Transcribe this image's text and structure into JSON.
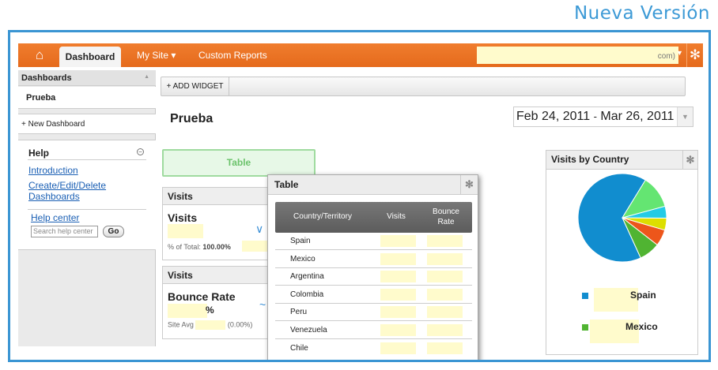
{
  "banner": "Nueva Versión",
  "topbar": {
    "tabs": [
      "Dashboard",
      "My Site ▾",
      "Custom Reports"
    ],
    "account_suffix": "com)"
  },
  "sidebar": {
    "dashboards_header": "Dashboards",
    "active_dashboard": "Prueba",
    "new_dashboard": "+ New Dashboard",
    "help": {
      "title": "Help",
      "links": [
        "Introduction",
        "Create/Edit/Delete",
        "Dashboards"
      ],
      "help_center": "Help center",
      "search_placeholder": "Search help center",
      "go": "Go"
    }
  },
  "toolbar": {
    "add_widget": "+ ADD WIDGET"
  },
  "page": {
    "title": "Prueba",
    "date_start": "Feb 24, 2011",
    "date_sep": "-",
    "date_end": "Mar 26, 2011"
  },
  "drop_placeholder": "Table",
  "visits_widget": {
    "title": "Visits",
    "metric": "Visits",
    "total_label": "% of Total:",
    "total_value": "100.00%"
  },
  "bounce_widget": {
    "title": "Visits",
    "metric": "Bounce Rate",
    "suffix": "%",
    "avg_label": "Site Avg",
    "avg_value": "(0.00%)"
  },
  "table_widget": {
    "title": "Table",
    "columns": [
      "Country/Territory",
      "Visits",
      "Bounce",
      "Rate"
    ],
    "rows": [
      "Spain",
      "Mexico",
      "Argentina",
      "Colombia",
      "Peru",
      "Venezuela",
      "Chile"
    ]
  },
  "country_widget": {
    "title": "Visits by Country",
    "legend": [
      "Spain",
      "Mexico"
    ],
    "colors": [
      "#118dcf",
      "#50b432",
      "#ed561b",
      "#dddf00",
      "#24cbe5",
      "#64e572"
    ],
    "slices": [
      0.6,
      0.07,
      0.055,
      0.04,
      0.04,
      0.11
    ]
  }
}
